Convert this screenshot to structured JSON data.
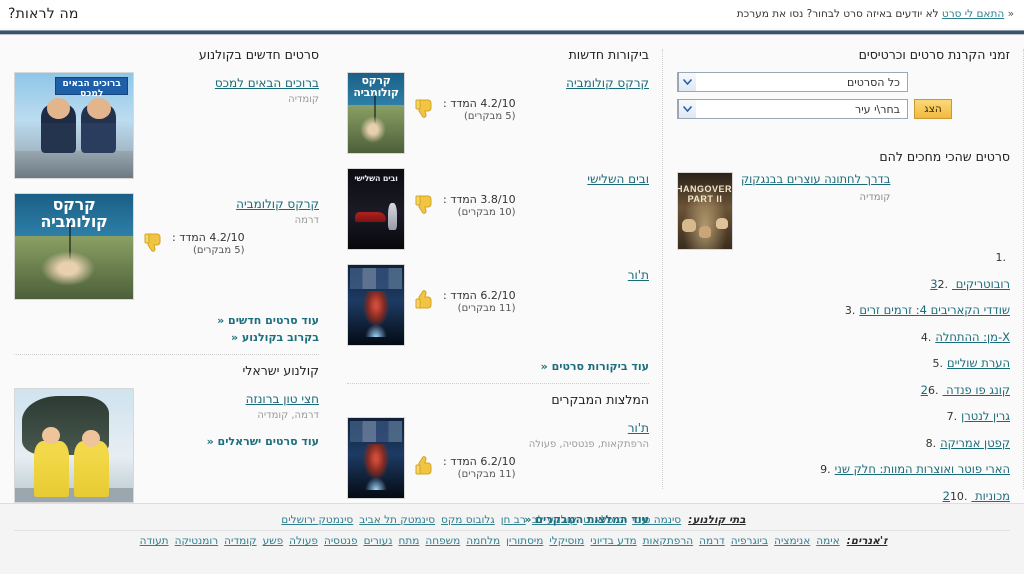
{
  "header": {
    "title": "מה לראות?",
    "promo_prefix": "לא יודעים באיזה סרט לבחור? נסו את מערכת",
    "promo_link": "התאם לי סרט",
    "promo_chevron": "«"
  },
  "showtimes": {
    "section_title": "זמני הקרנת סרטים וכרטיסים",
    "movie_select_value": "כל הסרטים",
    "city_select_value": "בחר\\י עיר",
    "submit_label": "הצג"
  },
  "waiting": {
    "section_title": "סרטים שהכי מחכים להם",
    "items": [
      {
        "rank": "1",
        "title": "בדרך לחתונה עוצרים בבנגקוק",
        "genre": "קומדיה",
        "poster": "hangover"
      },
      {
        "rank": "2",
        "title": "רובוטריקים 3"
      },
      {
        "rank": "3",
        "title": "שודדי הקאריבים 4: זרמים זרים"
      },
      {
        "rank": "4",
        "title": "X-מן: ההתחלה"
      },
      {
        "rank": "5",
        "title": "הערת שוליים"
      },
      {
        "rank": "6",
        "title": "קונג פו פנדה 2"
      },
      {
        "rank": "7",
        "title": "גרין לנטרן"
      },
      {
        "rank": "8",
        "title": "קפטן אמריקה"
      },
      {
        "rank": "9",
        "title": "הארי פוטר ואוצרות המוות: חלק שני"
      },
      {
        "rank": "10",
        "title": "מכוניות 2"
      }
    ]
  },
  "reviews": {
    "section_title": "ביקורות חדשות",
    "rating_prefix": "המדד :",
    "items": [
      {
        "title": "קרקס קולומביה",
        "rating": "4.2/10",
        "reviewers": "(5 מבקרים)",
        "thumb": "thumb-down-icon",
        "poster": "circus"
      },
      {
        "title": "ובים השלישי",
        "rating": "3.8/10",
        "reviewers": "(10 מבקרים)",
        "thumb": "thumb-down-icon",
        "poster": "tuesday"
      },
      {
        "title": "ת'ור",
        "rating": "6.2/10",
        "reviewers": "(11 מבקרים)",
        "thumb": "thumb-up-icon",
        "poster": "thor"
      }
    ],
    "more_label": "עוד ביקורות סרטים",
    "more_chevron": "«"
  },
  "recommendations": {
    "section_title": "המלצות המבקרים",
    "items": [
      {
        "title": "ת'ור",
        "genre": "הרפתקאות, פנטסיה, פעולה",
        "rating": "6.2/10",
        "reviewers": "(11 מבקרים)",
        "thumb": "thumb-up-icon",
        "poster": "thor"
      }
    ],
    "more_label": "עוד המלצות המבקרים",
    "more_chevron": "«"
  },
  "new_in_cinema": {
    "section_title": "סרטים חדשים בקולנוע",
    "items": [
      {
        "title": "ברוכים הבאים למכס",
        "genre": "קומדיה",
        "poster": "customs"
      },
      {
        "title": "קרקס קולומביה",
        "genre": "דרמה",
        "rating": "4.2/10",
        "reviewers": "(5 מבקרים)",
        "thumb": "thumb-down-icon",
        "poster": "circus"
      }
    ],
    "rating_prefix": "המדד :",
    "more_new_label": "עוד סרטים חדשים",
    "more_soon_label": "בקרוב בקולנוע",
    "chevron": "«"
  },
  "israeli_cinema": {
    "section_title": "קולנוע ישראלי",
    "items": [
      {
        "title": "חצי טון ברונזה",
        "genre": "דרמה, קומדיה",
        "poster": "bronze"
      }
    ],
    "more_label": "עוד סרטים ישראלים",
    "chevron": "«"
  },
  "footer": {
    "cinemas_label": "בתי קולנוע:",
    "cinemas": [
      "סינמה סיטי",
      "יס פלאנט",
      "קולנוע לב",
      "רב חן",
      "גלובוס מקס",
      "סינמטק תל אביב",
      "סינמטק ירושלים"
    ],
    "genres_label": "ז'אנרים:",
    "genres": [
      "אימה",
      "אנימציה",
      "ביוגרפיה",
      "דרמה",
      "הרפתקאות",
      "מדע בדיוני",
      "מוסיקלי",
      "מיסתורין",
      "מלחמה",
      "משפחה",
      "מתח",
      "נעורים",
      "פנטסיה",
      "פעולה",
      "פשע",
      "קומדיה",
      "רומנטיקה",
      "תעודה"
    ]
  },
  "colors": {
    "link": "#1a6b7a",
    "accent_bar": "#3f5266",
    "button": "#f3b940"
  }
}
